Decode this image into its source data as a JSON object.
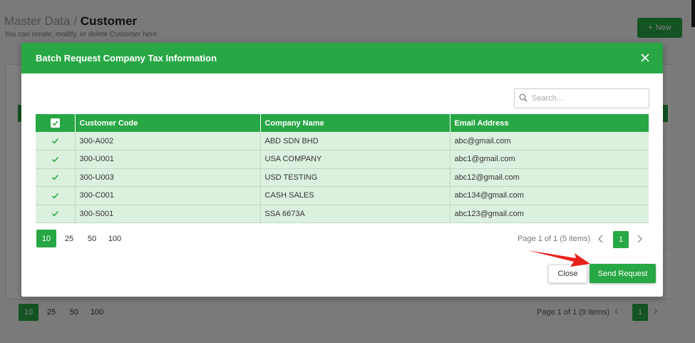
{
  "background": {
    "breadcrumb_parent": "Master Data",
    "breadcrumb_sep": "/",
    "breadcrumb_current": "Customer",
    "subtitle": "You can create, modify, or delete Customer here.",
    "new_button_label": "New",
    "page_sizes": [
      "10",
      "25",
      "50",
      "100"
    ],
    "page_info": "Page 1 of 1 (9 items)",
    "current_page": "1"
  },
  "modal": {
    "title": "Batch Request Company Tax Information",
    "search": {
      "placeholder": "Search..."
    },
    "columns": [
      "Customer Code",
      "Company Name",
      "Email Address"
    ],
    "rows": [
      {
        "code": "300-A002",
        "company": "ABD SDN BHD",
        "email": "abc@gmail.com",
        "checked": true
      },
      {
        "code": "300-U001",
        "company": "USA COMPANY",
        "email": "abc1@gmail.com",
        "checked": true
      },
      {
        "code": "300-U003",
        "company": "USD TESTING",
        "email": "abc12@gmail.com",
        "checked": true
      },
      {
        "code": "300-C001",
        "company": "CASH SALES",
        "email": "abc134@gmail.com",
        "checked": true
      },
      {
        "code": "300-S001",
        "company": "SSA 6673A",
        "email": "abc123@gmail.com",
        "checked": true
      }
    ],
    "page_sizes": [
      "10",
      "25",
      "50",
      "100"
    ],
    "active_page_size": "10",
    "page_info": "Page 1 of 1 (5 items)",
    "current_page": "1",
    "close_label": "Close",
    "send_label": "Send Request"
  },
  "colors": {
    "primary": "#28a745",
    "row_bg": "#dcf0de",
    "annotation": "#e8201c"
  },
  "icons": [
    "plus-icon",
    "close-icon",
    "search-icon",
    "checkbox-icon",
    "chevron-left-icon",
    "chevron-right-icon",
    "annotation-arrow-icon"
  ]
}
